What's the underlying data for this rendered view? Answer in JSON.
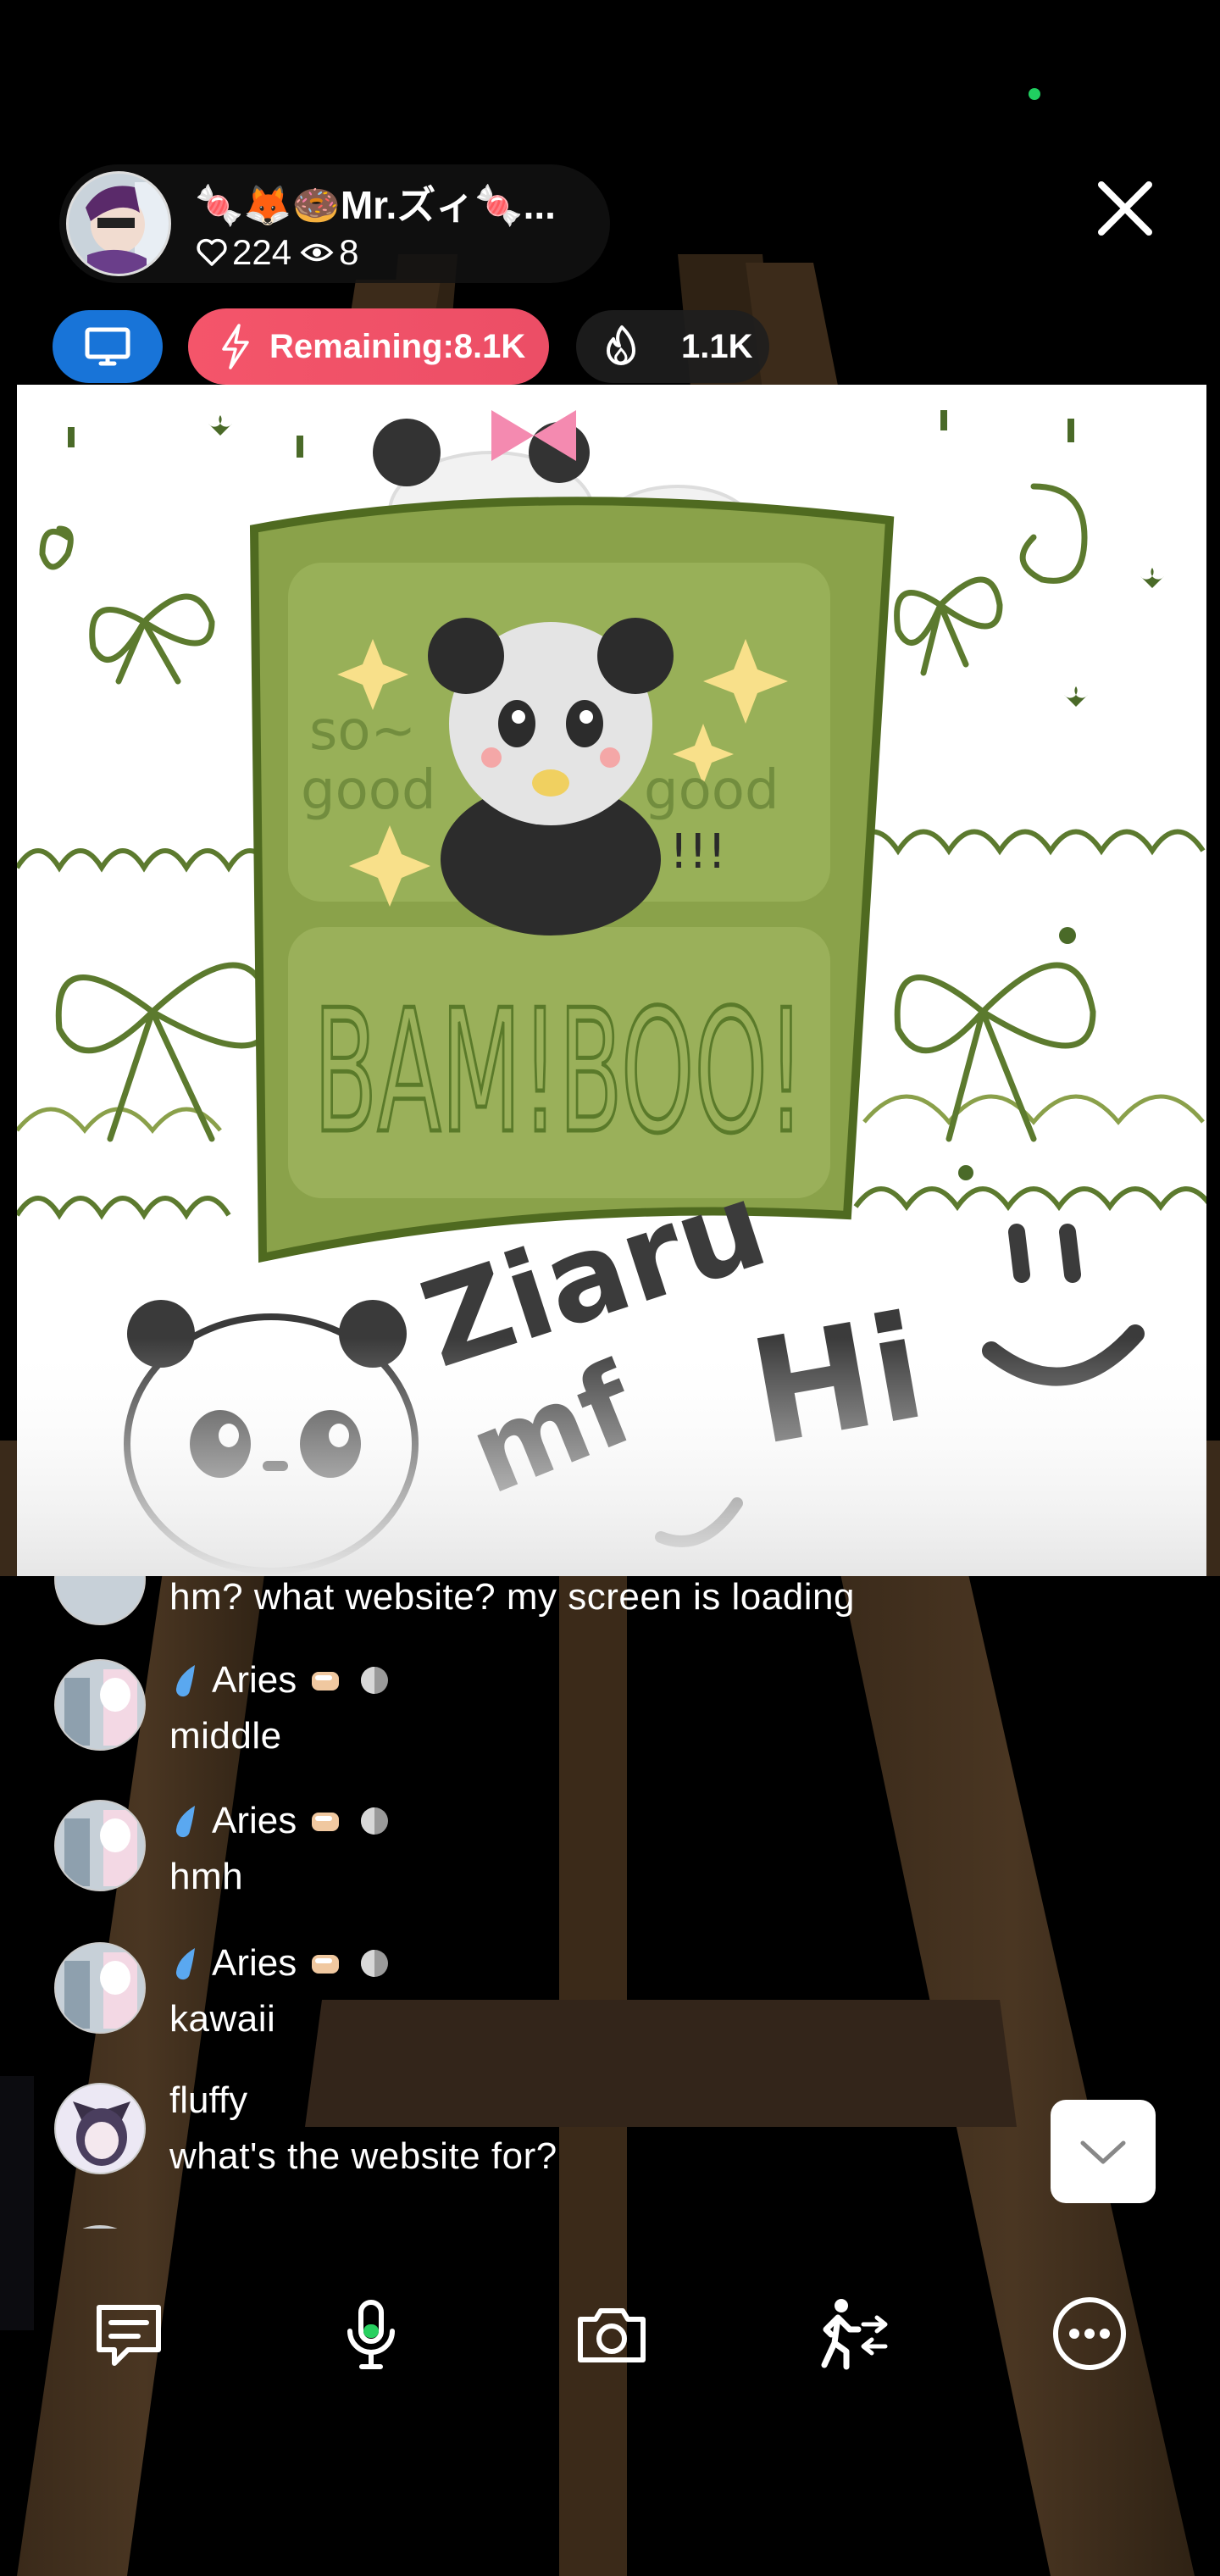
{
  "status": {
    "recording_dot_color": "#20d060"
  },
  "host": {
    "name": "🍬🦊🍩Mr.ズィ🍬...",
    "likes": "224",
    "viewers": "8"
  },
  "badges": {
    "screen_icon": "monitor-icon",
    "remaining_text": "Remaining:8.1K",
    "heat_value": "1.1K",
    "accent_blue": "#1874d8",
    "accent_pink": "#ef5068"
  },
  "chat": {
    "partial_top_text": "hm?  what website? my screen is loading",
    "messages": [
      {
        "user": "Aries",
        "text": "middle"
      },
      {
        "user": "Aries",
        "text": "hmh"
      },
      {
        "user": "Aries",
        "text": "kawaii"
      },
      {
        "user": "fluffy",
        "text": "what's the website for?"
      }
    ]
  },
  "toolbar": {
    "items": [
      "chat-icon",
      "microphone-icon",
      "camera-icon",
      "exit-walk-icon",
      "more-icon"
    ]
  }
}
